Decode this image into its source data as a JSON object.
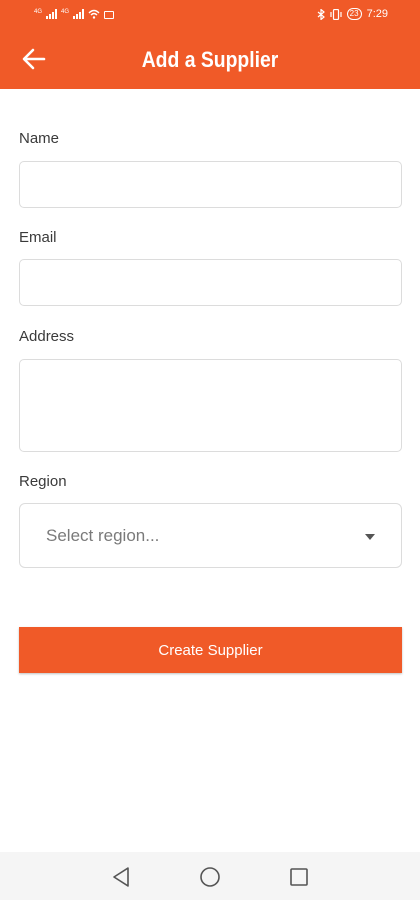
{
  "status_bar": {
    "net1": "4G",
    "net2": "4G",
    "battery": "23",
    "time": "7:29"
  },
  "header": {
    "title": "Add a Supplier",
    "back_icon": "arrow-left-icon",
    "background": "#f05a28"
  },
  "form": {
    "name_label": "Name",
    "name_value": "",
    "email_label": "Email",
    "email_value": "",
    "address_label": "Address",
    "address_value": "",
    "region_label": "Region",
    "region_placeholder": "Select region...",
    "submit_label": "Create Supplier"
  },
  "navbar": {
    "back_icon": "triangle-back-icon",
    "home_icon": "circle-home-icon",
    "recents_icon": "square-recents-icon"
  }
}
